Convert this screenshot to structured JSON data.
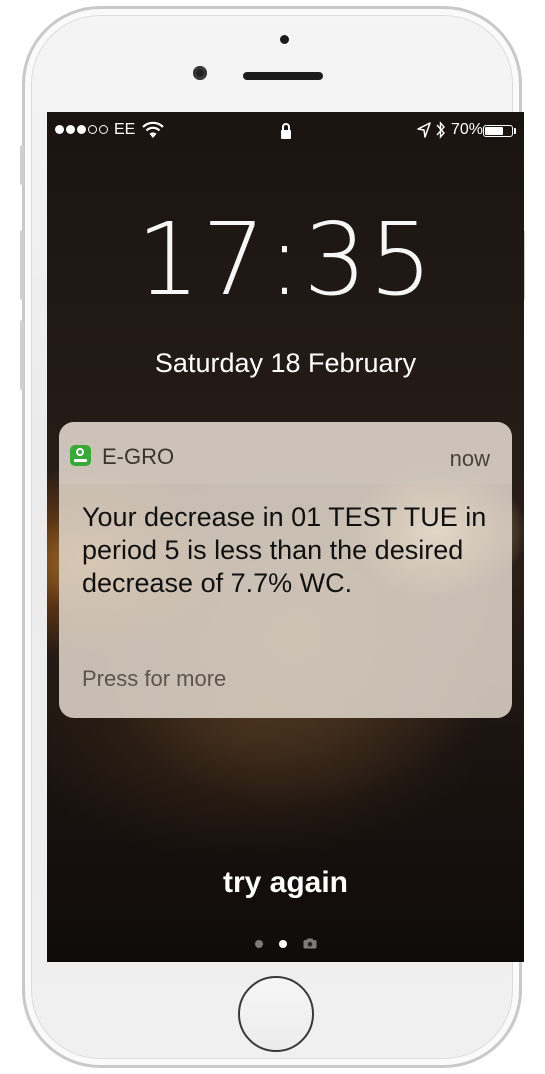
{
  "status_bar": {
    "signal_full": 3,
    "signal_total": 5,
    "carrier": "EE",
    "battery_percent": "70%",
    "battery_level": 0.7,
    "icons": [
      "signal-dots-icon",
      "wifi-icon",
      "lock-icon",
      "location-arrow-icon",
      "bluetooth-icon",
      "battery-icon"
    ]
  },
  "lock_screen": {
    "time": "17:35",
    "date": "Saturday 18 February"
  },
  "notification": {
    "app_icon": "e-gro-app-icon",
    "app_name": "E-GRO",
    "timestamp": "now",
    "message": "Your decrease in 01 TEST TUE  in period 5 is less than the desired decrease of 7.7% WC.",
    "more_hint": "Press for more"
  },
  "bottom": {
    "prompt": "try again",
    "pages": [
      "dot",
      "dot-active",
      "camera"
    ]
  },
  "colors": {
    "app_icon": "#3aa836",
    "text_light": "#ffffff",
    "notif_body_text": "#111111"
  }
}
